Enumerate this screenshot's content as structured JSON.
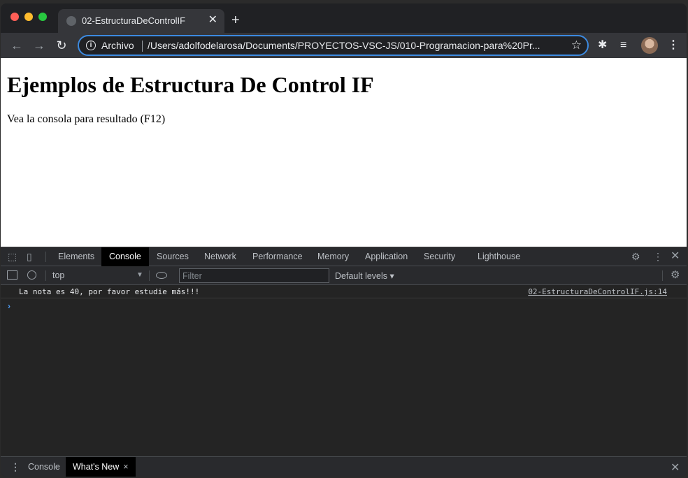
{
  "tab": {
    "title": "02-EstructuraDeControlIF",
    "close_glyph": "✕",
    "new_tab_glyph": "+"
  },
  "toolbar": {
    "back_glyph": "←",
    "forward_glyph": "→",
    "reload_glyph": "↻",
    "scheme_label": "Archivo",
    "url": "/Users/adolfodelarosa/Documents/PROYECTOS-VSC-JS/010-Programacion-para%20Pr...",
    "star_glyph": "☆",
    "extensions_glyph": "✱",
    "media_glyph": "≡",
    "menu_glyph": "⋮"
  },
  "page": {
    "heading": "Ejemplos de Estructura De Control IF",
    "paragraph": "Vea la consola para resultado (F12)"
  },
  "devtools": {
    "tabs": [
      "Elements",
      "Console",
      "Sources",
      "Network",
      "Performance",
      "Memory",
      "Application",
      "Security",
      "Lighthouse"
    ],
    "active_tab": "Console",
    "settings_glyph": "⚙",
    "more_glyph": "⋮",
    "close_glyph": "✕",
    "console": {
      "context": "top",
      "context_arrow": "▼",
      "filter_placeholder": "Filter",
      "levels": "Default levels ▾",
      "log_message": "La nota es 40, por favor estudie más!!!",
      "log_source": "02-EstructuraDeControlIF.js:14",
      "prompt_glyph": "›"
    },
    "drawer": {
      "tabs": [
        "Console",
        "What's New"
      ],
      "active_tab": "What's New",
      "tab_close_glyph": "×",
      "close_glyph": "✕",
      "menu_glyph": "⋮"
    }
  }
}
